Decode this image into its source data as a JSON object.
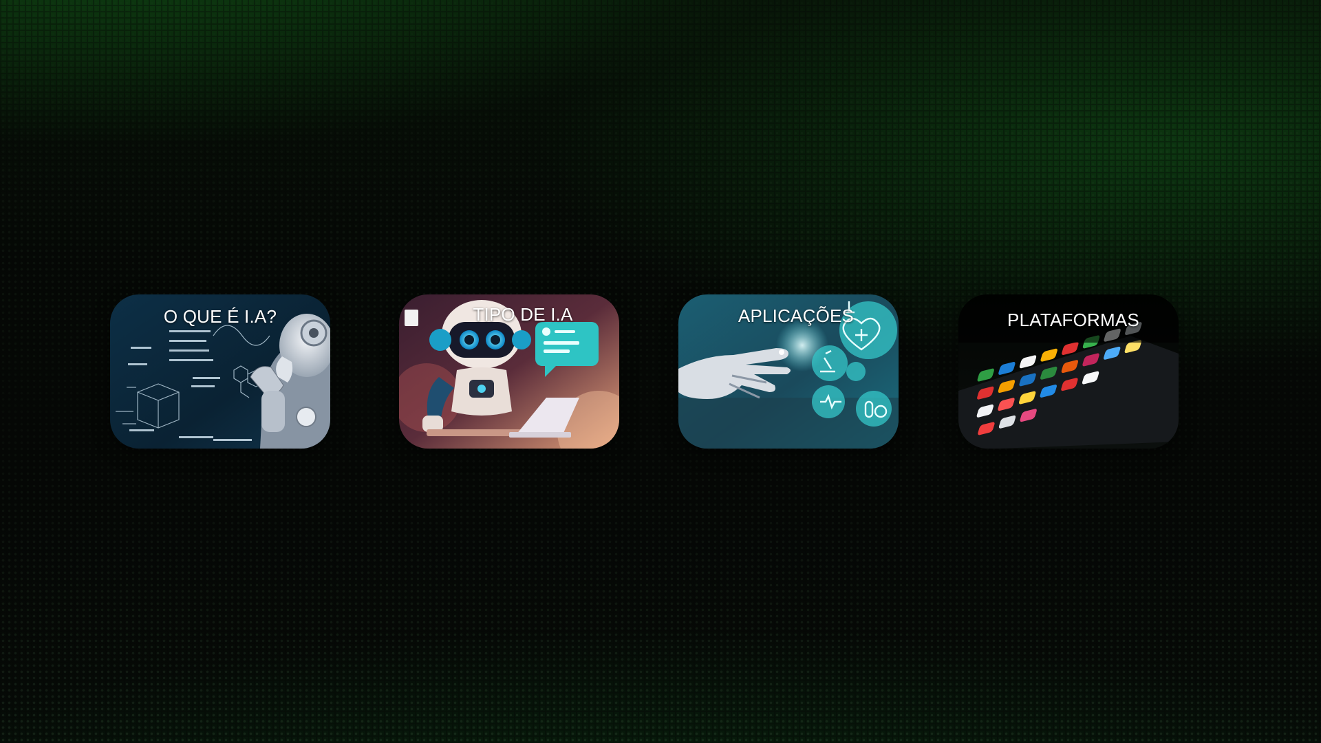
{
  "menu": {
    "cards": [
      {
        "id": "what-is-ai",
        "label": "O QUE É I.A?",
        "image": "robot-thinking-math"
      },
      {
        "id": "ai-types",
        "label": "TIPO DE I.A",
        "image": "robot-laptop-chat"
      },
      {
        "id": "applications",
        "label": "APLICAÇÕES",
        "image": "robot-hand-health-icons"
      },
      {
        "id": "platforms",
        "label": "PLATAFORMAS",
        "image": "smartphone-app-icons"
      }
    ]
  },
  "colors": {
    "background": "#060806",
    "glow": "#146e1c",
    "label": "#ffffff"
  }
}
